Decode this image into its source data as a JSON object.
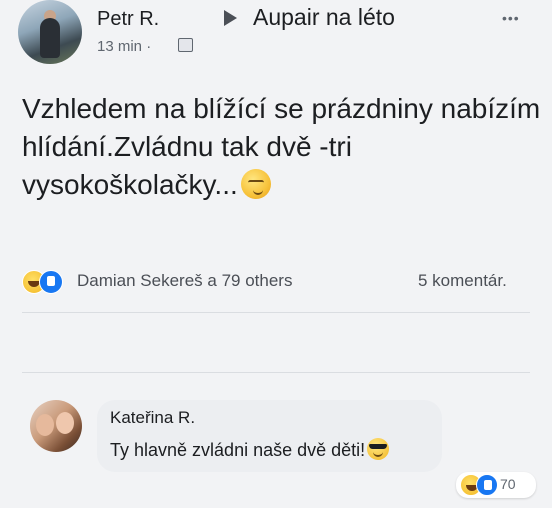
{
  "post": {
    "author": "Petr R.",
    "group": "Aupair na léto",
    "timestamp": "13 min ·",
    "text": "Vzhledem na blížící se prázdniny nabízím hlídání.Zvládnu tak dvě -tri vysokoškolačky...",
    "more_icon": "•••"
  },
  "reactions": {
    "summary": "Damian Sekereš a 79 others",
    "comments": "5 komentár."
  },
  "comment": {
    "author": "Kateřina R.",
    "text": "Ty hlavně zvládni naše dvě děti!",
    "reaction_count": "70"
  },
  "icons": {
    "arrow": "triangle-right",
    "audience": "group-audience-icon",
    "smirk": "smirking-face-emoji",
    "cool": "sunglasses-face-emoji",
    "haha": "haha-reaction",
    "like": "like-reaction"
  },
  "colors": {
    "background": "#f2f3f5",
    "text": "#1c1e21",
    "secondary_text": "#606770",
    "like_blue": "#1877f2",
    "emoji_yellow": "#f2b623"
  }
}
